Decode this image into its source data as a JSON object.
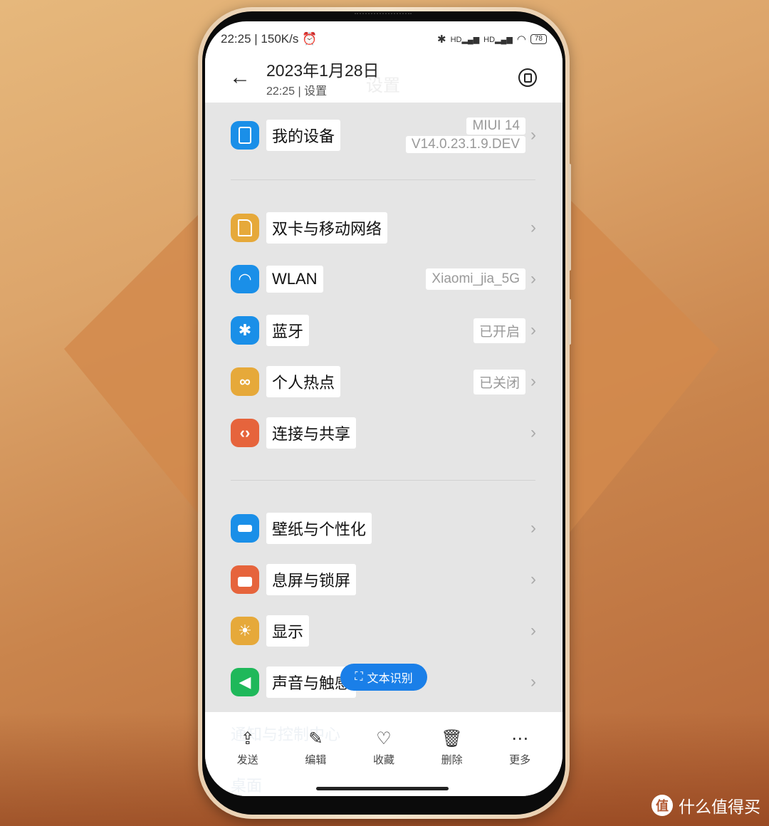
{
  "statusbar": {
    "time": "22:25",
    "speed": "150K/s",
    "alarm_icon": "alarm-clock-icon",
    "icons": [
      "bluetooth-icon",
      "signal-hd-icon",
      "signal-hd-icon",
      "wifi-icon"
    ],
    "battery": "78"
  },
  "header": {
    "title": "2023年1月28日",
    "subtitle": "22:25 | 设置",
    "ghost_title": "设置",
    "back_icon": "arrow-left-icon",
    "rotate_icon": "rotate-screen-icon"
  },
  "settings": {
    "my_device": {
      "label": "我的设备",
      "value_line1": "MIUI 14",
      "value_line2": "V14.0.23.1.9.DEV",
      "color": "#1a8fe8"
    },
    "items": [
      {
        "label": "双卡与移动网络",
        "value": "",
        "color": "#e6a93a",
        "icon": "sim-card-icon"
      },
      {
        "label": "WLAN",
        "value": "Xiaomi_jia_5G",
        "color": "#1a8fe8",
        "icon": "wifi-icon"
      },
      {
        "label": "蓝牙",
        "value": "已开启",
        "color": "#1a8fe8",
        "icon": "bluetooth-icon"
      },
      {
        "label": "个人热点",
        "value": "已关闭",
        "color": "#e6a93a",
        "icon": "hotspot-icon"
      },
      {
        "label": "连接与共享",
        "value": "",
        "color": "#e6643c",
        "icon": "share-icon"
      },
      {
        "label": "壁纸与个性化",
        "value": "",
        "color": "#1a8fe8",
        "icon": "wallpaper-icon"
      },
      {
        "label": "息屏与锁屏",
        "value": "",
        "color": "#e6643c",
        "icon": "lock-icon"
      },
      {
        "label": "显示",
        "value": "",
        "color": "#e6a93a",
        "icon": "brightness-icon"
      },
      {
        "label": "声音与触感",
        "value": "",
        "color": "#1fb85a",
        "icon": "sound-icon"
      }
    ],
    "ghost_items": [
      "通知与控制中心",
      "桌面"
    ]
  },
  "ocr_button": {
    "label": "文本识别",
    "icon": "text-scan-icon"
  },
  "bottom_actions": [
    {
      "label": "发送",
      "icon": "share-upload-icon",
      "glyph": "⇪"
    },
    {
      "label": "编辑",
      "icon": "edit-icon",
      "glyph": "✎"
    },
    {
      "label": "收藏",
      "icon": "heart-icon",
      "glyph": "♡"
    },
    {
      "label": "删除",
      "icon": "trash-icon",
      "glyph": "🗑"
    },
    {
      "label": "更多",
      "icon": "more-icon",
      "glyph": "⋯"
    }
  ],
  "watermark": {
    "logo": "值",
    "text": "什么值得买"
  }
}
